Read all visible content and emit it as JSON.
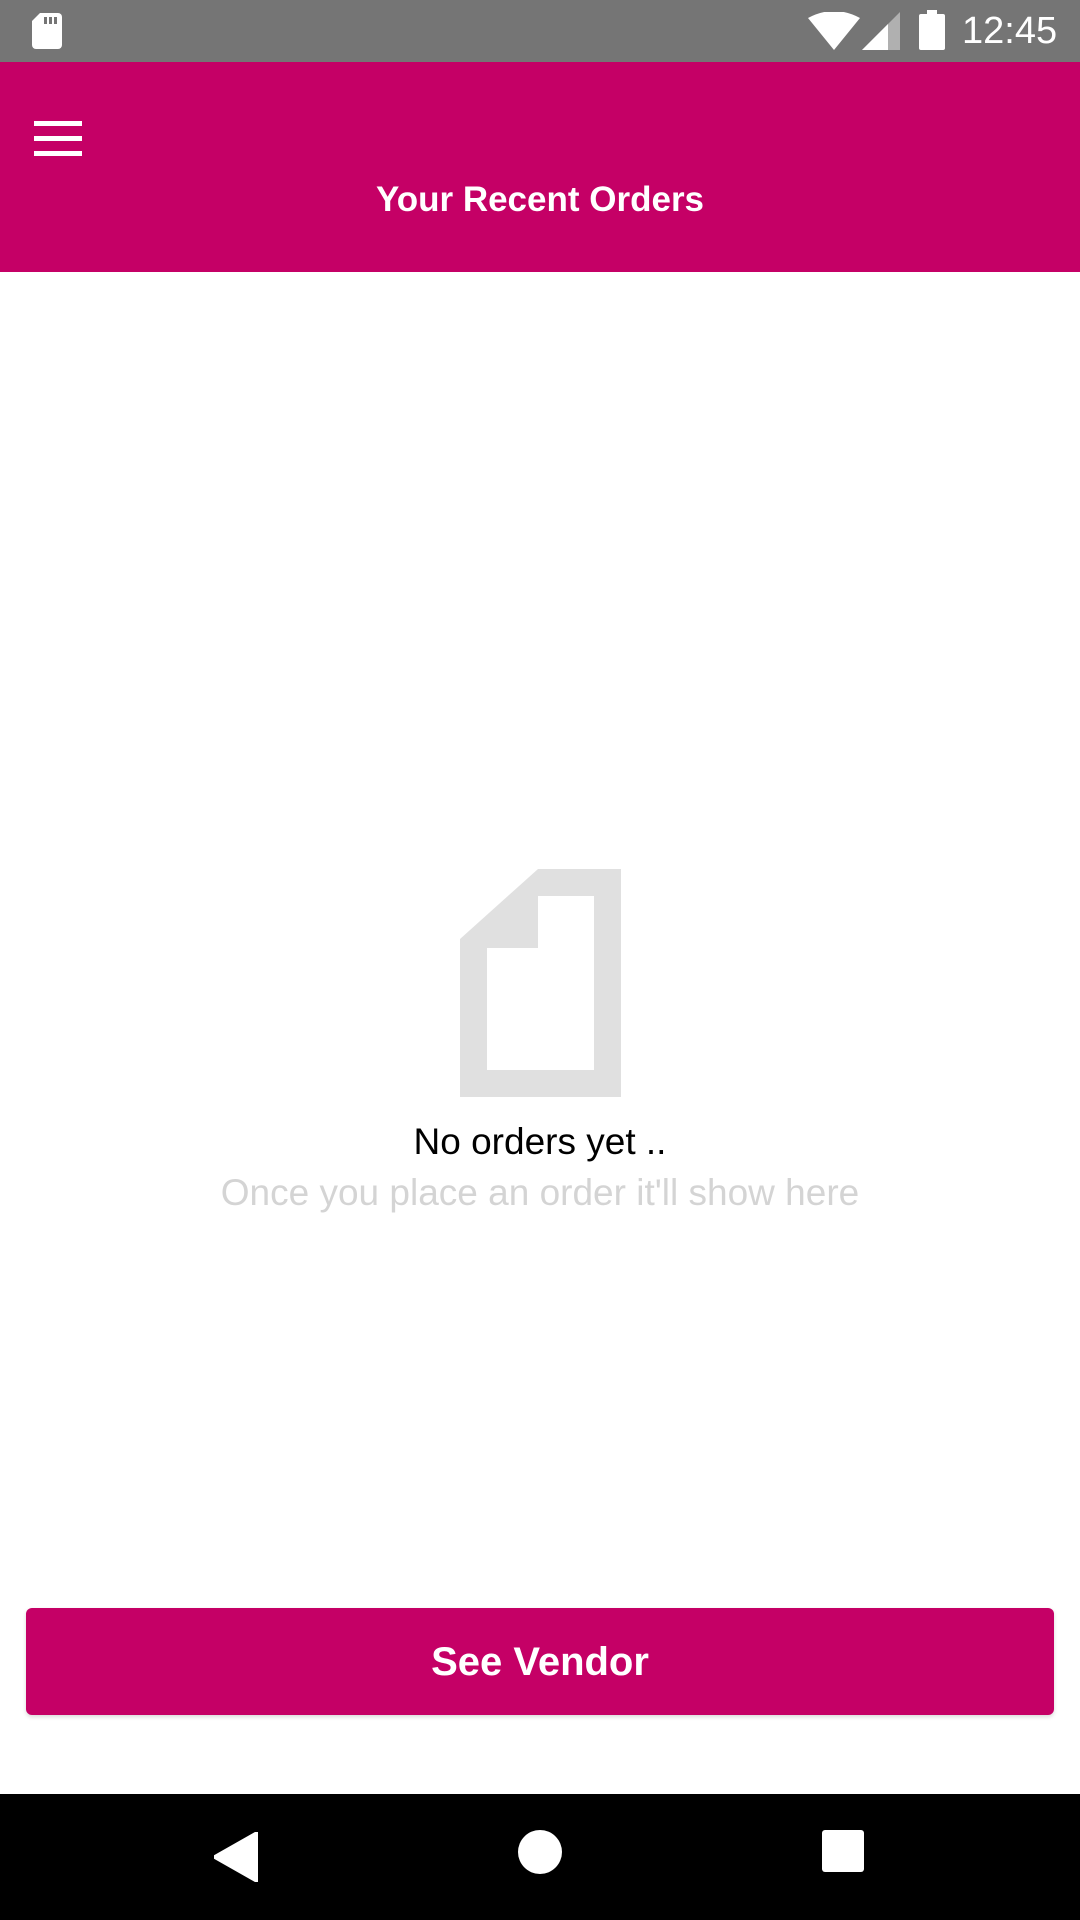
{
  "status_bar": {
    "time": "12:45",
    "icons": [
      "sd-card-icon",
      "wifi-icon",
      "signal-icon",
      "battery-icon"
    ]
  },
  "app_bar": {
    "title": "Your Recent Orders",
    "menu_icon": "menu-icon",
    "background_color": "#c50066"
  },
  "empty_state": {
    "icon": "document-icon",
    "title": "No orders yet ..",
    "subtitle": "Once you place an order it'll show here"
  },
  "actions": {
    "see_vendor_label": "See Vendor"
  },
  "nav_bar": {
    "icons": [
      "back-icon",
      "home-icon",
      "recents-icon"
    ]
  },
  "colors": {
    "accent": "#c50066",
    "status_bar": "#757575",
    "empty_icon": "#e0e0e0",
    "subtitle_text": "#d4d4d4"
  }
}
